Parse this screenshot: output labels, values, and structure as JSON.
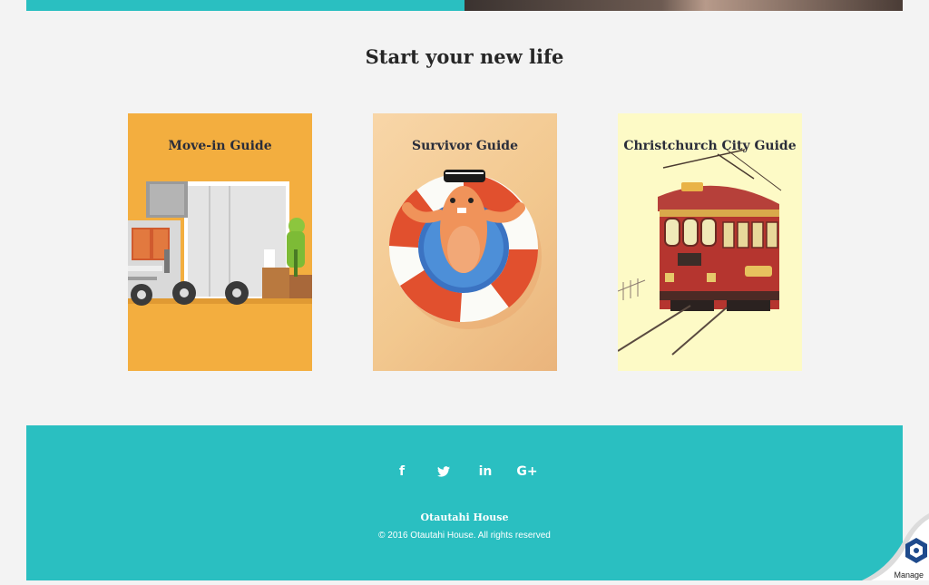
{
  "section": {
    "title": "Start your new life"
  },
  "cards": [
    {
      "title": "Move-in Guide"
    },
    {
      "title": "Survivor Guide"
    },
    {
      "title": "Christchurch City Guide"
    }
  ],
  "footer": {
    "social": [
      {
        "icon": "facebook-icon",
        "glyph": "f"
      },
      {
        "icon": "twitter-icon",
        "glyph": "🐦"
      },
      {
        "icon": "linkedin-icon",
        "glyph": "in"
      },
      {
        "icon": "google-plus-icon",
        "glyph": "G+"
      }
    ],
    "name": "Otautahi House",
    "copyright": "© 2016 Otautahi House. All rights reserved"
  },
  "widget": {
    "label": "Manage"
  },
  "colors": {
    "teal": "#2abfc1",
    "orange": "#f3ae3f",
    "pale_yellow": "#fdfac6",
    "text": "#262626"
  }
}
